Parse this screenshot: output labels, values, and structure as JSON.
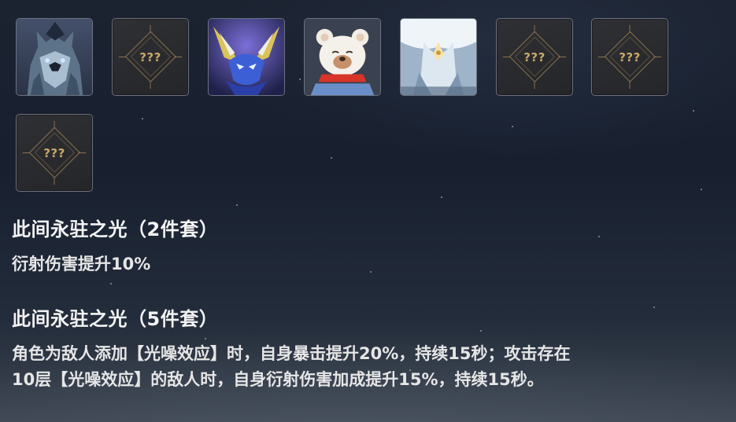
{
  "slots": [
    {
      "type": "portrait",
      "icon": "wolf-portrait-icon"
    },
    {
      "type": "unknown",
      "label": "???"
    },
    {
      "type": "portrait",
      "icon": "winged-mask-portrait-icon"
    },
    {
      "type": "portrait",
      "icon": "bear-portrait-icon"
    },
    {
      "type": "portrait",
      "icon": "white-robed-figure-portrait-icon"
    },
    {
      "type": "unknown",
      "label": "???"
    },
    {
      "type": "unknown",
      "label": "???"
    },
    {
      "type": "unknown",
      "label": "???"
    }
  ],
  "set_bonus": {
    "two_piece": {
      "title": "此间永驻之光（2件套）",
      "desc": "衍射伤害提升10%"
    },
    "five_piece": {
      "title": "此间永驻之光（5件套）",
      "desc_line1": "角色为敌人添加【光噪效应】时，自身暴击提升20%，持续15秒；攻击存在",
      "desc_line2": "10层【光噪效应】的敌人时，自身衍射伤害加成提升15%，持续15秒。"
    }
  },
  "colors": {
    "accent_gold": "#c9a86a",
    "slot_border": "#6d7280",
    "text": "#ececec"
  }
}
